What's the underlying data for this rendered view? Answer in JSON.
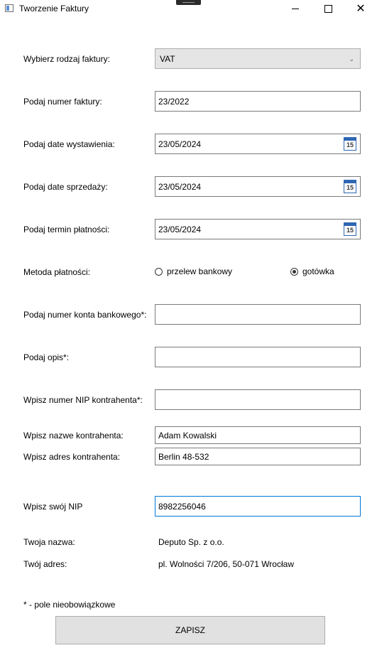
{
  "window": {
    "title": "Tworzenie Faktury"
  },
  "form": {
    "invoice_type": {
      "label": "Wybierz rodzaj faktury:",
      "value": "VAT"
    },
    "invoice_number": {
      "label": "Podaj numer faktury:",
      "value": "23/2022"
    },
    "issue_date": {
      "label": "Podaj date wystawienia:",
      "value": "23/05/2024",
      "calendar_day": "15"
    },
    "sale_date": {
      "label": "Podaj date sprzedaży:",
      "value": "23/05/2024",
      "calendar_day": "15"
    },
    "payment_deadline": {
      "label": "Podaj termin płatności:",
      "value": "23/05/2024",
      "calendar_day": "15"
    },
    "payment_method": {
      "label": "Metoda płatności:",
      "options": [
        {
          "label": "przelew bankowy",
          "checked": false
        },
        {
          "label": "gotówka",
          "checked": true
        }
      ]
    },
    "bank_account": {
      "label": "Podaj numer konta bankowego*:",
      "value": ""
    },
    "description": {
      "label": "Podaj opis*:",
      "value": ""
    },
    "contractor_nip": {
      "label": "Wpisz numer NIP kontrahenta*:",
      "value": ""
    },
    "contractor_name": {
      "label": "Wpisz nazwe kontrahenta:",
      "value": "Adam Kowalski"
    },
    "contractor_address": {
      "label": "Wpisz adres kontrahenta:",
      "value": "Berlin 48-532"
    },
    "own_nip": {
      "label": "Wpisz swój NIP",
      "value": "8982256046"
    },
    "own_name": {
      "label": "Twoja nazwa:",
      "value": "Deputo Sp. z o.o."
    },
    "own_address": {
      "label": "Twój adres:",
      "value": "pl. Wolności 7/206, 50-071 Wrocław"
    },
    "optional_note": "* - pole nieobowiązkowe",
    "save_label": "ZAPISZ"
  },
  "colors": {
    "focus_border": "#0078d7",
    "calendar_accent": "#2e66b3",
    "combo_bg": "#e5e5e5",
    "button_bg": "#e1e1e1"
  }
}
